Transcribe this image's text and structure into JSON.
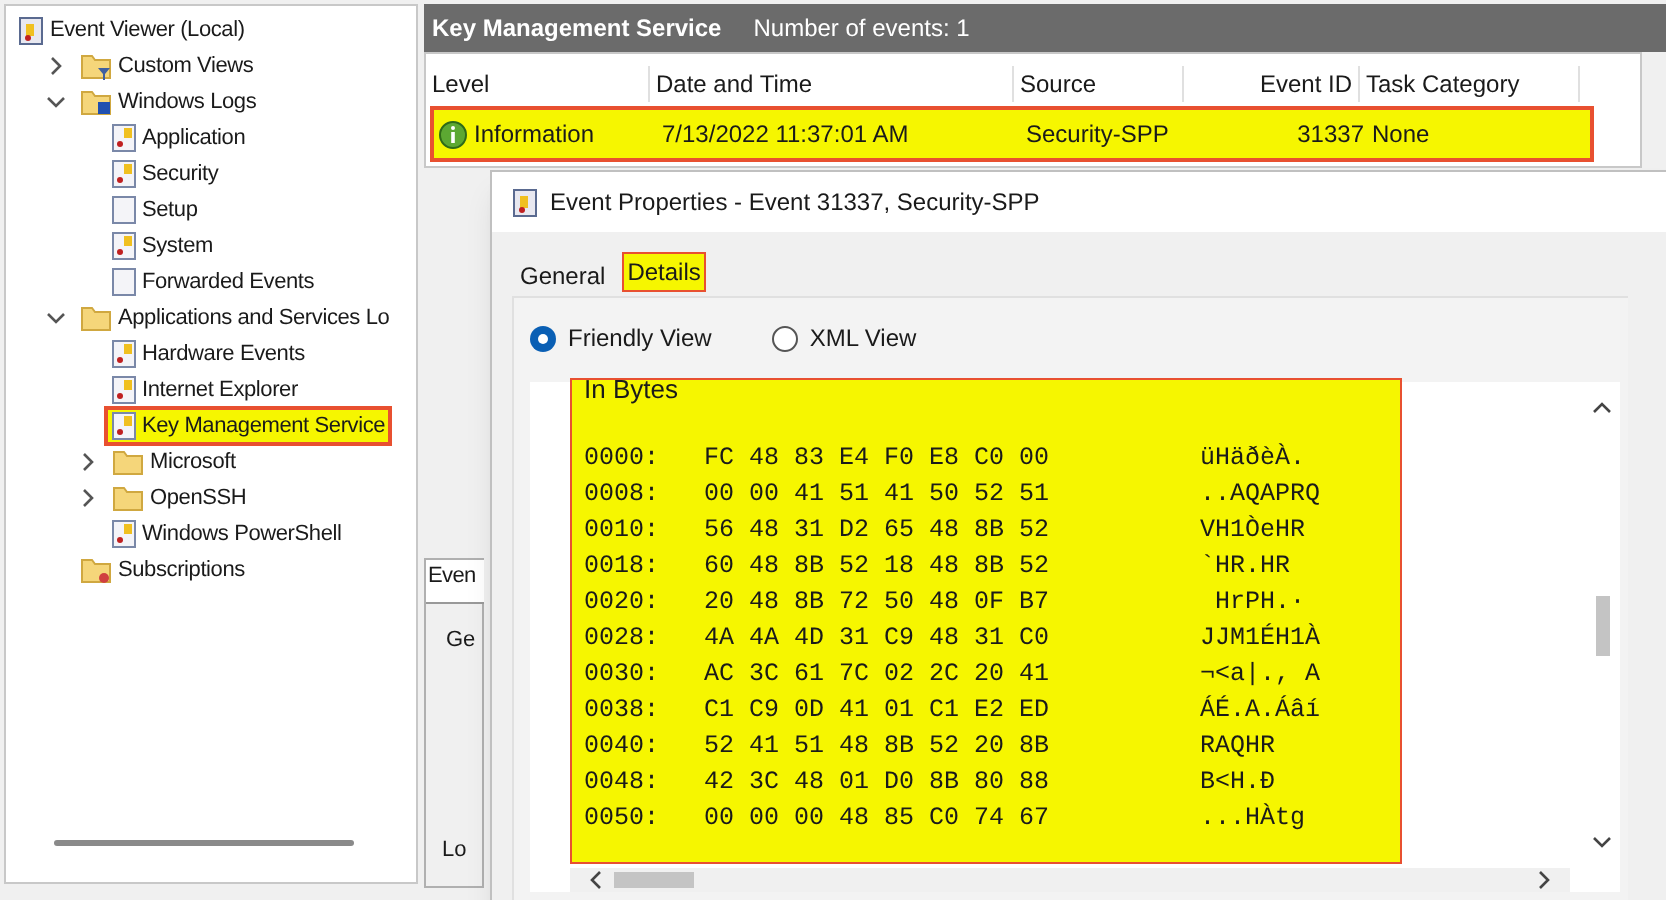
{
  "tree": [
    {
      "label": "Event Viewer (Local)",
      "kind": "root",
      "selected": false,
      "children": [
        {
          "label": "Custom Views",
          "kind": "folder-filter",
          "expanded": false,
          "selected": false
        },
        {
          "label": "Windows Logs",
          "kind": "folder-log",
          "expanded": true,
          "selected": false,
          "children": [
            {
              "label": "Application",
              "kind": "log",
              "selected": false
            },
            {
              "label": "Security",
              "kind": "log",
              "selected": false
            },
            {
              "label": "Setup",
              "kind": "log-empty",
              "selected": false
            },
            {
              "label": "System",
              "kind": "log",
              "selected": false
            },
            {
              "label": "Forwarded Events",
              "kind": "log-empty",
              "selected": false
            }
          ]
        },
        {
          "label": "Applications and Services Lo",
          "kind": "folder",
          "expanded": true,
          "selected": false,
          "children": [
            {
              "label": "Hardware Events",
              "kind": "log",
              "selected": false
            },
            {
              "label": "Internet Explorer",
              "kind": "log",
              "selected": false
            },
            {
              "label": "Key Management Service",
              "kind": "log",
              "selected": true
            },
            {
              "label": "Microsoft",
              "kind": "folder",
              "expanded": false,
              "selected": false
            },
            {
              "label": "OpenSSH",
              "kind": "folder",
              "expanded": false,
              "selected": false
            },
            {
              "label": "Windows PowerShell",
              "kind": "log",
              "selected": false
            }
          ]
        },
        {
          "label": "Subscriptions",
          "kind": "subscriptions",
          "selected": false
        }
      ]
    }
  ],
  "log_header": {
    "title": "Key Management Service",
    "count": "Number of events: 1"
  },
  "table": {
    "columns": [
      "Level",
      "Date and Time",
      "Source",
      "Event ID",
      "Task Category"
    ],
    "rows": [
      {
        "level": "Information",
        "date": "7/13/2022 11:37:01 AM",
        "source": "Security-SPP",
        "event_id": "31337",
        "task_category": "None",
        "selected": true
      }
    ]
  },
  "lower_pane": {
    "tab": "Even",
    "subtab": "Ge",
    "label": "Lo"
  },
  "dialog": {
    "title": "Event Properties - Event 31337, Security-SPP",
    "tabs": [
      {
        "label": "General",
        "selected": false
      },
      {
        "label": "Details",
        "selected": true
      }
    ],
    "views": [
      {
        "label": "Friendly View",
        "selected": true
      },
      {
        "label": "XML View",
        "selected": false
      }
    ],
    "heading": "In Bytes",
    "lines": [
      {
        "offset": "0000:",
        "bytes": "FC 48 83 E4 F0 E8 C0 00",
        "ascii": "üHäðèÀ."
      },
      {
        "offset": "0008:",
        "bytes": "00 00 41 51 41 50 52 51",
        "ascii": "..AQAPRQ"
      },
      {
        "offset": "0010:",
        "bytes": "56 48 31 D2 65 48 8B 52",
        "ascii": "VH1ÒeHR"
      },
      {
        "offset": "0018:",
        "bytes": "60 48 8B 52 18 48 8B 52",
        "ascii": "`HR.HR"
      },
      {
        "offset": "0020:",
        "bytes": "20 48 8B 72 50 48 0F B7",
        "ascii": " HrPH.·"
      },
      {
        "offset": "0028:",
        "bytes": "4A 4A 4D 31 C9 48 31 C0",
        "ascii": "JJM1ÉH1À"
      },
      {
        "offset": "0030:",
        "bytes": "AC 3C 61 7C 02 2C 20 41",
        "ascii": "¬<a|., A"
      },
      {
        "offset": "0038:",
        "bytes": "C1 C9 0D 41 01 C1 E2 ED",
        "ascii": "ÁÉ.A.Áâí"
      },
      {
        "offset": "0040:",
        "bytes": "52 41 51 48 8B 52 20 8B",
        "ascii": "RAQHR"
      },
      {
        "offset": "0048:",
        "bytes": "42 3C 48 01 D0 8B 80 88",
        "ascii": "B<H.Ð"
      },
      {
        "offset": "0050:",
        "bytes": "00 00 00 48 85 C0 74 67",
        "ascii": "...HÀtg"
      }
    ]
  }
}
